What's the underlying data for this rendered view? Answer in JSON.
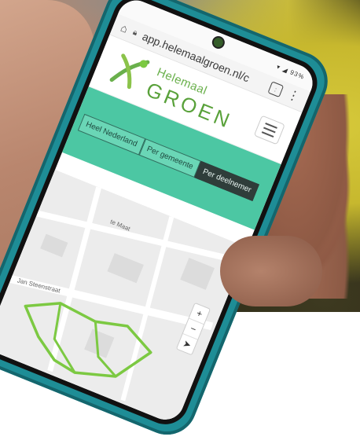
{
  "browser": {
    "url": "app.helemaalgroen.nl/c",
    "status_icons": "▾ ◢ 93%"
  },
  "site": {
    "logo_line1": "Helemaal",
    "logo_line2": "GROEN"
  },
  "filters": [
    {
      "label": "Heel Nederland",
      "active": false
    },
    {
      "label": "Per gemeente",
      "active": false
    },
    {
      "label": "Per deelnemer",
      "active": true
    }
  ],
  "map": {
    "street_1": "te Maat",
    "street_2": "Jan Steenstraat",
    "route_color": "#7cc942"
  },
  "colors": {
    "brand_green": "#59a13a",
    "hero_teal": "#4cc7a3",
    "phone_case": "#1e8d96"
  }
}
